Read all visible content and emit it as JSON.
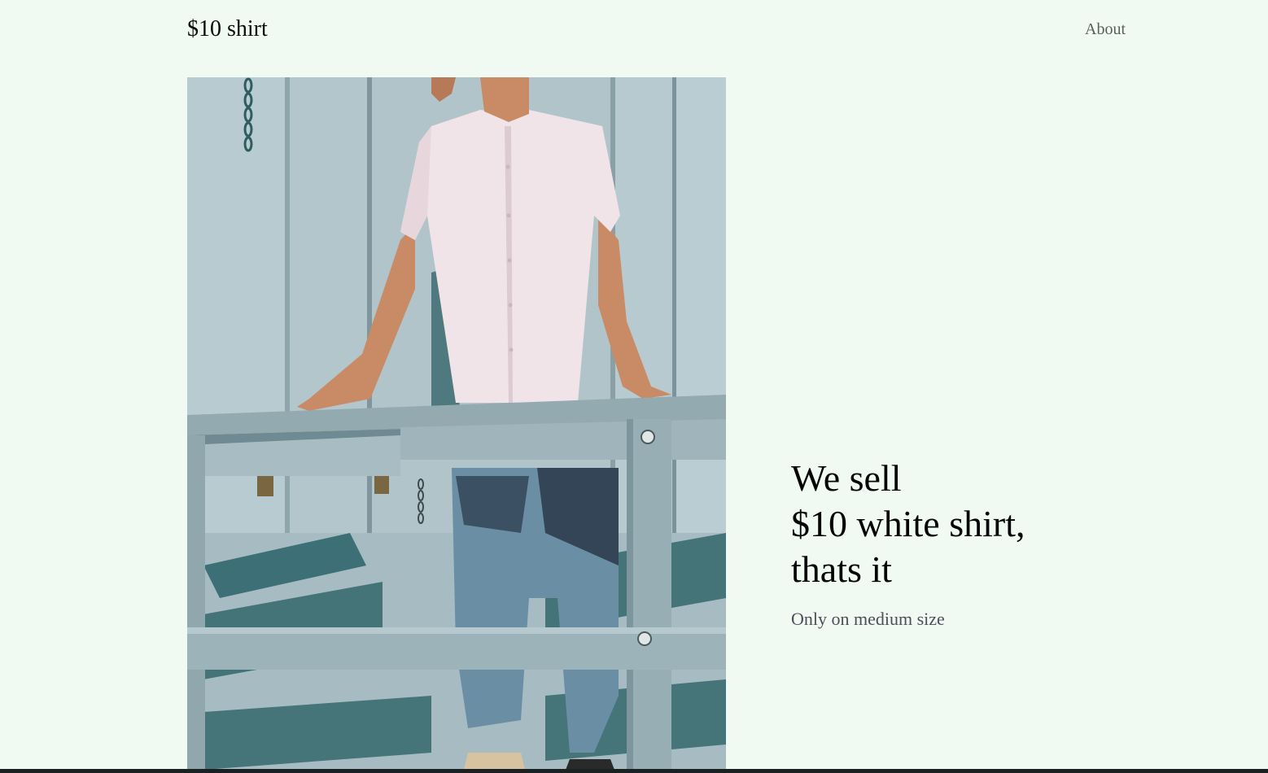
{
  "header": {
    "logo": "$10 shirt",
    "nav": {
      "about": "About"
    }
  },
  "hero": {
    "image_alt": "Man in white short-sleeve shirt and jeans leaning on a pale blue railing",
    "headline_lines": [
      "We sell",
      "$10 white shirt,",
      "thats it"
    ],
    "subtitle": "Only on medium size"
  },
  "colors": {
    "background": "#f0faf2",
    "text": "#050505",
    "muted_text": "#4e4e58",
    "nav_text": "#5c5c5c",
    "bottom_bar": "#1b2020"
  }
}
